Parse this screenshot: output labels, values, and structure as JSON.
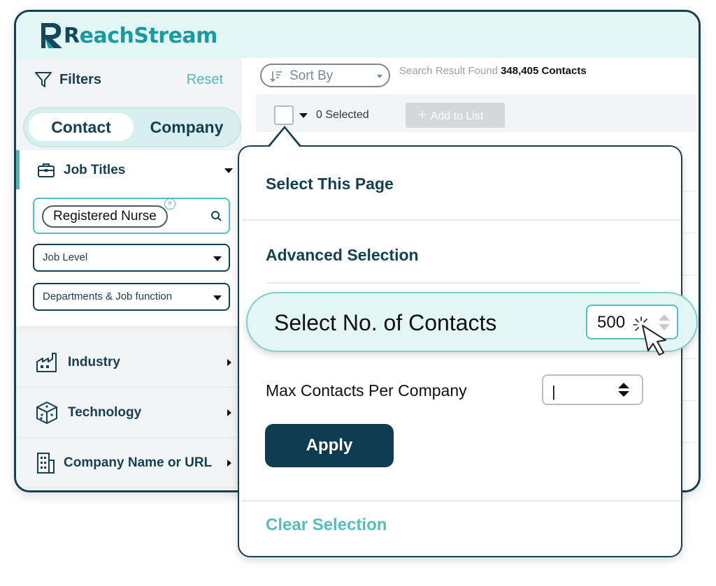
{
  "app": {
    "logo_initial": "R",
    "logo_rest": "eachStream",
    "colors": {
      "brand_dark": "#163f52",
      "brand_teal": "#1b9aa0",
      "accent": "#4fb8b6",
      "button": "#0e3b50"
    }
  },
  "sidebar": {
    "filters_label": "Filters",
    "reset_label": "Reset",
    "tabs": [
      {
        "label": "Contact",
        "active": true
      },
      {
        "label": "Company",
        "active": false
      }
    ],
    "job_titles": {
      "label": "Job Titles",
      "chip": "Registered Nurse",
      "job_level_placeholder": "Job Level",
      "departments_placeholder": "Departments & Job function"
    },
    "items": [
      {
        "label": "Industry",
        "icon": "factory-icon"
      },
      {
        "label": "Technology",
        "icon": "cube-circuit-icon"
      },
      {
        "label": "Company Name or URL",
        "icon": "building-icon"
      }
    ]
  },
  "main": {
    "sort_label": "Sort By",
    "result_prefix": "Search Result Found",
    "result_count": "348,405 Contacts",
    "selected_label": "0 Selected",
    "add_to_list_label": "Add to List"
  },
  "popup": {
    "select_page": "Select This Page",
    "advanced_selection": "Advanced Selection",
    "select_no_label": "Select No. of Contacts",
    "select_no_value": "500",
    "max_per_company_label": "Max Contacts Per Company",
    "max_per_company_value": "|",
    "apply_label": "Apply",
    "clear_label": "Clear Selection"
  }
}
